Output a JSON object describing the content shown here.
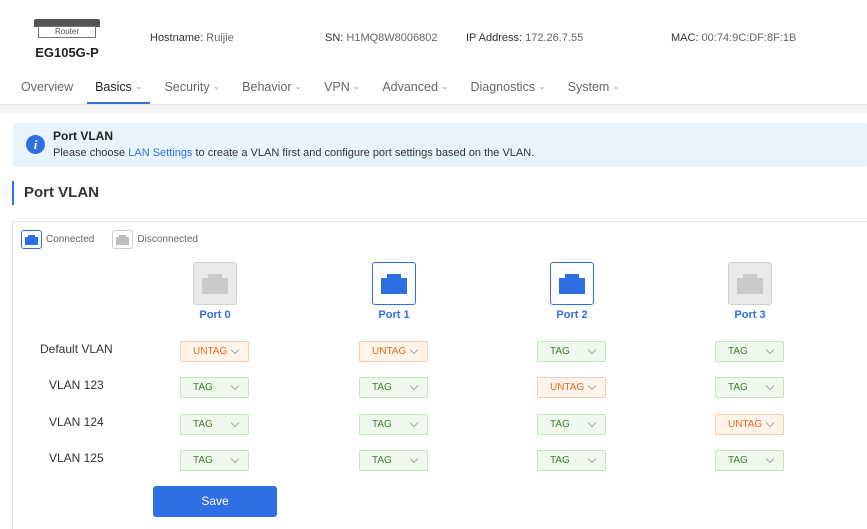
{
  "header": {
    "device_icon_label": "Router",
    "model": "EG105G-P",
    "hostname_label": "Hostname:",
    "hostname": "Ruijie",
    "sn_label": "SN:",
    "sn": "H1MQ8W8006802",
    "ip_label": "IP Address:",
    "ip": "172.26.7.55",
    "mac_label": "MAC:",
    "mac": "00:74:9C:DF:8F:1B"
  },
  "nav": {
    "items": [
      {
        "label": "Overview"
      },
      {
        "label": "Basics"
      },
      {
        "label": "Security"
      },
      {
        "label": "Behavior"
      },
      {
        "label": "VPN"
      },
      {
        "label": "Advanced"
      },
      {
        "label": "Diagnostics"
      },
      {
        "label": "System"
      }
    ],
    "active": "Basics"
  },
  "alert": {
    "title": "Port VLAN",
    "text_before": "Please choose",
    "link": "LAN Settings",
    "text_after": "to create a VLAN first and configure port settings based on the VLAN."
  },
  "section_title": "Port VLAN",
  "legend": {
    "connected": "Connected",
    "disconnected": "Disconnected"
  },
  "ports": [
    {
      "label": "Port 0",
      "status": "disconnected"
    },
    {
      "label": "Port 1",
      "status": "connected"
    },
    {
      "label": "Port 2",
      "status": "connected"
    },
    {
      "label": "Port 3",
      "status": "disconnected"
    }
  ],
  "vlans": [
    {
      "label": "Default VLAN",
      "values": [
        "UNTAG",
        "UNTAG",
        "TAG",
        "TAG"
      ]
    },
    {
      "label": "VLAN 123",
      "values": [
        "TAG",
        "TAG",
        "UNTAG",
        "TAG"
      ]
    },
    {
      "label": "VLAN 124",
      "values": [
        "TAG",
        "TAG",
        "TAG",
        "UNTAG"
      ]
    },
    {
      "label": "VLAN 125",
      "values": [
        "TAG",
        "TAG",
        "TAG",
        "TAG"
      ]
    }
  ],
  "save_label": "Save",
  "colors": {
    "accent": "#2f6fe4",
    "tag_text": "#3f7d2f",
    "untag_text": "#e56a1f"
  }
}
